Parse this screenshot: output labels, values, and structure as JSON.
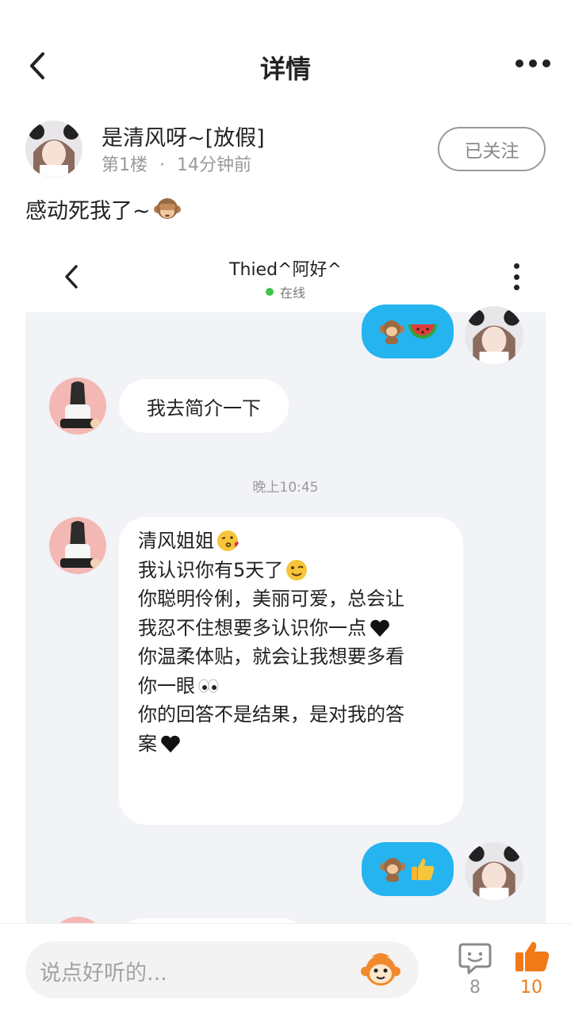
{
  "header": {
    "title": "详情"
  },
  "post": {
    "author_name": "是清风呀~[放假]",
    "floor": "第1楼",
    "dot": "·",
    "time_ago": "14分钟前",
    "follow_label": "已关注",
    "text": "感动死我了~"
  },
  "chat_screenshot": {
    "contact_name": "Thied^阿好^",
    "status": "在线",
    "messages": [
      {
        "side": "right",
        "content": "🐒🍉"
      },
      {
        "side": "left",
        "content": "我去简介一下"
      },
      {
        "type": "time",
        "content": "晚上10:45"
      },
      {
        "side": "left",
        "lines": [
          "清风姐姐",
          "我认识你有5天了",
          "你聪明伶俐，美丽可爱，总会让",
          "我忍不住想要多认识你一点",
          "你温柔体贴，就会让我想要多看",
          "你一眼",
          "你的回答不是结果，是对我的答",
          "案"
        ]
      },
      {
        "side": "right",
        "content": "🐒👍"
      }
    ]
  },
  "bottom_bar": {
    "input_placeholder": "说点好听的...",
    "comment_count": "8",
    "like_count": "10"
  },
  "colors": {
    "accent_orange": "#f07a16",
    "bubble_blue": "#25b4f0",
    "online_green": "#3ec44a"
  }
}
